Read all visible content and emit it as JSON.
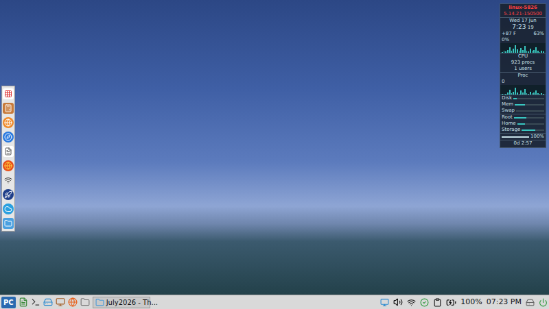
{
  "conky": {
    "host": "linux-5826",
    "kernel": "5.14.21-150500",
    "date": "Wed 17 Jun",
    "time": "7:23",
    "seconds": "19",
    "temperature": "+87 F",
    "battery": "63%",
    "cpu_usage": "0%",
    "cpu_graph": [
      10,
      20,
      15,
      30,
      60,
      25,
      40,
      80,
      35,
      20,
      50,
      30,
      70,
      25,
      15,
      40,
      20,
      30,
      55,
      20,
      10,
      25,
      15
    ],
    "cpu_label": "CPU",
    "procs": "923 procs",
    "users": "1 users",
    "proc_label": "Proc",
    "proc_value": "0",
    "proc_graph": [
      5,
      10,
      8,
      20,
      50,
      15,
      30,
      70,
      25,
      10,
      40,
      20,
      60,
      15,
      10,
      30,
      12,
      20,
      45,
      15,
      8,
      15,
      10
    ],
    "meters": [
      {
        "label": "Disk",
        "level": 0.1
      },
      {
        "label": "Mem",
        "level": 0.35
      },
      {
        "label": "Swap",
        "level": 0.0
      }
    ],
    "filesystems": [
      {
        "label": "Root",
        "level": 0.4
      },
      {
        "label": "Home",
        "level": 0.3
      },
      {
        "label": "Storage",
        "level": 0.6
      }
    ],
    "volume": "100%",
    "volume_level": 1.0,
    "uptime": "0d 2:57"
  },
  "taskbar": {
    "start_button": "PC",
    "windows": [
      {
        "title": "July2026 - Th...",
        "selected": false
      }
    ],
    "battery": "100%",
    "battery_level": 1.0,
    "clock": "07:23 PM"
  }
}
